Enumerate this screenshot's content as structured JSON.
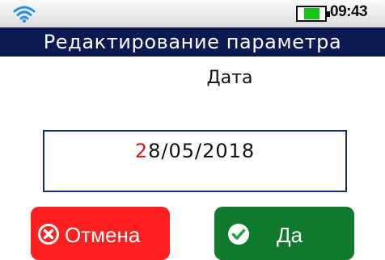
{
  "status_bar": {
    "wifi_icon": "wifi-icon",
    "battery_icon": "battery-icon",
    "time": "09:43"
  },
  "title": "Редактирование  параметра",
  "field": {
    "label": "Дата",
    "value_cursor_char": "2",
    "value_rest": "8/05/2018"
  },
  "buttons": {
    "cancel": {
      "label": "Отмена",
      "icon": "cancel-x-icon",
      "color": "#ff1f1f"
    },
    "ok": {
      "label": "Да",
      "icon": "check-icon",
      "color": "#107a2c"
    }
  },
  "colors": {
    "title_bar": "#0d1a52",
    "cursor": "#e01414",
    "battery_level": "#18c418"
  }
}
